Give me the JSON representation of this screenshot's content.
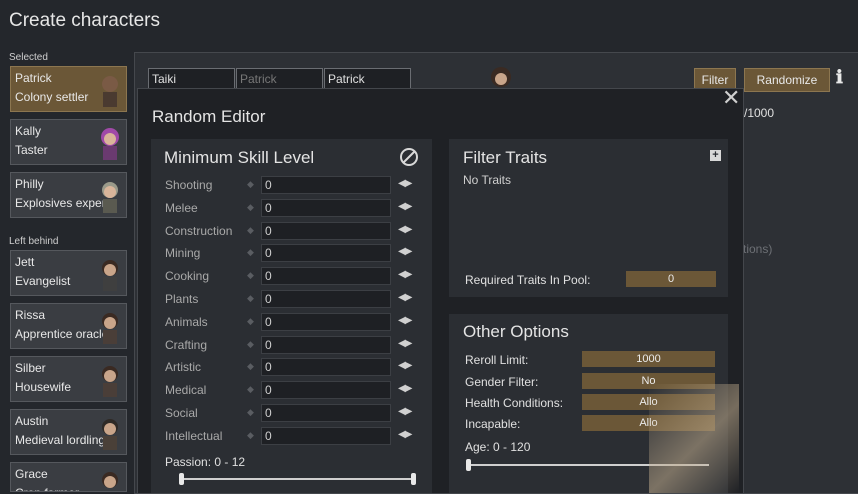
{
  "page": {
    "title": "Create characters"
  },
  "sidebar": {
    "selected_heading": "Selected",
    "left_behind_heading": "Left behind",
    "selected": [
      {
        "name": "Patrick",
        "role": "Colony settler"
      },
      {
        "name": "Kally",
        "role": "Taster"
      },
      {
        "name": "Philly",
        "role": "Explosives expert"
      }
    ],
    "left_behind": [
      {
        "name": "Jett",
        "role": "Evangelist"
      },
      {
        "name": "Rissa",
        "role": "Apprentice oracle"
      },
      {
        "name": "Silber",
        "role": "Housewife"
      },
      {
        "name": "Austin",
        "role": "Medieval lordling"
      },
      {
        "name": "Grace",
        "role": "Crop farmer"
      }
    ]
  },
  "background": {
    "name_first": "Taiki",
    "name_nick": "Patrick",
    "name_last": "Patrick",
    "filter_label": "Filter",
    "randomize_label": "Randomize",
    "counter_text": "/1000",
    "options_fragment": "tions)"
  },
  "modal": {
    "title": "Random Editor",
    "close_glyph": "✕",
    "min_skill": {
      "title": "Minimum Skill Level",
      "skills": [
        {
          "label": "Shooting",
          "value": "0"
        },
        {
          "label": "Melee",
          "value": "0"
        },
        {
          "label": "Construction",
          "value": "0"
        },
        {
          "label": "Mining",
          "value": "0"
        },
        {
          "label": "Cooking",
          "value": "0"
        },
        {
          "label": "Plants",
          "value": "0"
        },
        {
          "label": "Animals",
          "value": "0"
        },
        {
          "label": "Crafting",
          "value": "0"
        },
        {
          "label": "Artistic",
          "value": "0"
        },
        {
          "label": "Medical",
          "value": "0"
        },
        {
          "label": "Social",
          "value": "0"
        },
        {
          "label": "Intellectual",
          "value": "0"
        }
      ],
      "passion_label": "Passion: 0 - 12"
    },
    "filter_traits": {
      "title": "Filter Traits",
      "add_glyph": "+",
      "empty_text": "No Traits",
      "required_label": "Required Traits In Pool:",
      "required_value": "0"
    },
    "other_options": {
      "title": "Other Options",
      "rows": [
        {
          "label": "Reroll Limit:",
          "value": "1000"
        },
        {
          "label": "Gender Filter:",
          "value": "No"
        },
        {
          "label": "Health Conditions:",
          "value": "Allo"
        },
        {
          "label": "Incapable:",
          "value": "Allo"
        }
      ],
      "age_label": "Age: 0 - 120"
    }
  },
  "colors": {
    "accent": "#6b5737",
    "background": "#24272c",
    "modal": "#1f2125"
  }
}
